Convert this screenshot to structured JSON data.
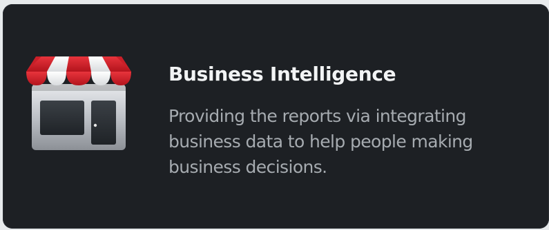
{
  "card": {
    "title": "Business Intelligence",
    "description": "Providing the reports via integrating business data to help people making business decisions.",
    "icon": "storefront-icon"
  },
  "colors": {
    "card_background": "#1d2024",
    "title": "#f2f4f5",
    "description": "#a6abb0",
    "awning_red": "#d8242d",
    "awning_white": "#f5f5f5"
  }
}
